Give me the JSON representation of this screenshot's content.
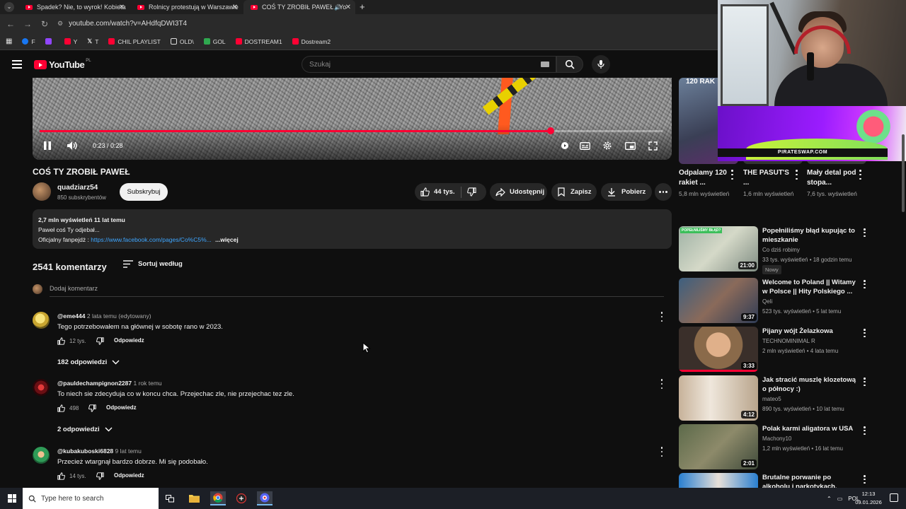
{
  "browser": {
    "tabs": [
      {
        "title": "Spadek? Nie, to wyrok! Kobieta",
        "active": false
      },
      {
        "title": "Rolnicy protestują w Warszawie",
        "active": false
      },
      {
        "title": "COŚ TY ZROBIŁ PAWEŁ - Yo",
        "active": true
      }
    ],
    "url": "youtube.com/watch?v=AHdfqDWI3T4",
    "bookmarks": [
      "F",
      "Y",
      "T",
      "CHIL PLAYLIST",
      "OLD\\",
      "GOL",
      "DOSTREAM1",
      "Dostream2"
    ]
  },
  "youtube": {
    "logo_text": "YouTube",
    "logo_country": "PL",
    "search_placeholder": "Szukaj"
  },
  "player": {
    "timecode": "0:23 / 0:28",
    "progress_fraction": 0.82
  },
  "video": {
    "title": "COŚ TY ZROBIŁ PAWEŁ",
    "channel": "quadziarz54",
    "subscribers": "850 subskrybentów",
    "subscribe_label": "Subskrybuj",
    "likes": "44 tys.",
    "share_label": "Udostępnij",
    "save_label": "Zapisz",
    "download_label": "Pobierz",
    "description": {
      "stats": "2,7 mln wyświetleń  11 lat temu",
      "line1": "Paweł coś Ty odjebał...",
      "fanpage_label": "Oficjalny fanpejdż : ",
      "fanpage_link": "https://www.facebook.com/pages/Co%C5%...",
      "more": "...więcej"
    }
  },
  "comments": {
    "count_label": "2541 komentarzy",
    "sort_label": "Sortuj według",
    "add_placeholder": "Dodaj komentarz",
    "items": [
      {
        "author": "@eme444",
        "meta": "2 lata temu (edytowany)",
        "text": "Tego potrzebowałem na głównej w sobotę rano w 2023.",
        "likes": "12 tys.",
        "reply": "Odpowiedz",
        "replies": "182 odpowiedzi"
      },
      {
        "author": "@pauldechampignon2287",
        "meta": "1 rok temu",
        "text": "To niech sie zdecyduja co w koncu chca. Przejechac zle, nie przejechac tez zle.",
        "likes": "498",
        "reply": "Odpowiedz",
        "replies": "2 odpowiedzi"
      },
      {
        "author": "@kubakuboski6828",
        "meta": "9 lat temu",
        "text": "Przecież wtargnął bardzo dobrze. Mi się podobało.",
        "likes": "14 tys.",
        "reply": "Odpowiedz",
        "replies": ""
      }
    ]
  },
  "sidebar": {
    "shorts": [
      {
        "title": "Odpalamy 120 rakiet ...",
        "views": "5,8 mln wyświetleń",
        "thumb_text": "120 RAK"
      },
      {
        "title": "THE PASUT'S ...",
        "views": "1,6 mln wyświetleń"
      },
      {
        "title": "Mały detal pod stopa...",
        "views": "7,6 tys. wyświetleń"
      }
    ],
    "videos": [
      {
        "title": "Popełniliśmy błąd kupując to mieszkanie",
        "channel": "Co dziś robimy",
        "meta": "33 tys. wyświetleń • 18 godzin temu",
        "badge": "Nowy",
        "duration": "21:00",
        "thumb_text": "POPEŁNILIŚMY BŁĄD?"
      },
      {
        "title": "Welcome to Poland || Witamy w Polsce || Hity Polskiego ...",
        "channel": "Qeli",
        "meta": "523 tys. wyświetleń • 5 lat temu",
        "duration": "9:37"
      },
      {
        "title": "Pijany wójt Żelazkowa",
        "channel": "TECHNOMINIMAL R",
        "meta": "2 mln wyświetleń • 4 lata temu",
        "duration": "3:33",
        "watched": true
      },
      {
        "title": "Jak stracić muszlę klozetową o północy :)",
        "channel": "mateo5",
        "meta": "890 tys. wyświetleń • 10 lat temu",
        "duration": "4:12"
      },
      {
        "title": "Polak karmi aligatora w USA",
        "channel": "Machony10",
        "meta": "1,2 mln wyświetleń • 16 lat temu",
        "duration": "2:01"
      },
      {
        "title": "Brutalne porwanie po alkoholu i narkotykach. Honorowy ...",
        "channel": "",
        "meta": ""
      }
    ]
  },
  "overlay": {
    "promo_label": "PIRATESWAP.COM"
  },
  "taskbar": {
    "search_placeholder": "Type here to search",
    "language": "POL",
    "time": "12:13",
    "date": "09.01.2026"
  },
  "colors": {
    "background": "#0f0f0f",
    "accent": "#ff0033",
    "link": "#3ea6ff"
  }
}
